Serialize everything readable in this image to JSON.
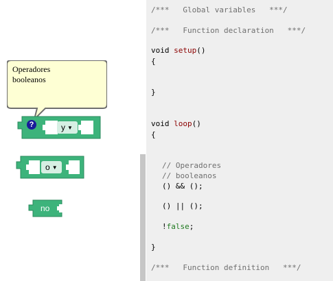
{
  "tooltip": {
    "line1": "Operadores",
    "line2": "booleanos"
  },
  "blocks": {
    "and_block": {
      "operator": "y",
      "help": "?"
    },
    "or_block": {
      "operator": "o"
    },
    "not_block": {
      "label": "no"
    }
  },
  "colors": {
    "block_green": "#3db37b",
    "tooltip_bg": "#feffd4",
    "code_bg": "#efefef"
  },
  "code": {
    "global_vars": "/***   Global variables   ***/",
    "func_decl": "/***   Function declaration   ***/",
    "void1": "void",
    "setup": "setup",
    "paren1": "()",
    "brace_open1": "{",
    "brace_close1": "}",
    "void2": "void",
    "loop": "loop",
    "paren2": "()",
    "brace_open2": "{",
    "comment1": "// Operadores",
    "comment2": "// booleanos",
    "and_expr": "() && ();",
    "or_expr": "() || ();",
    "not_bang": "!",
    "not_false": "false",
    "not_semi": ";",
    "brace_close2": "}",
    "func_def": "/***   Function definition   ***/"
  }
}
